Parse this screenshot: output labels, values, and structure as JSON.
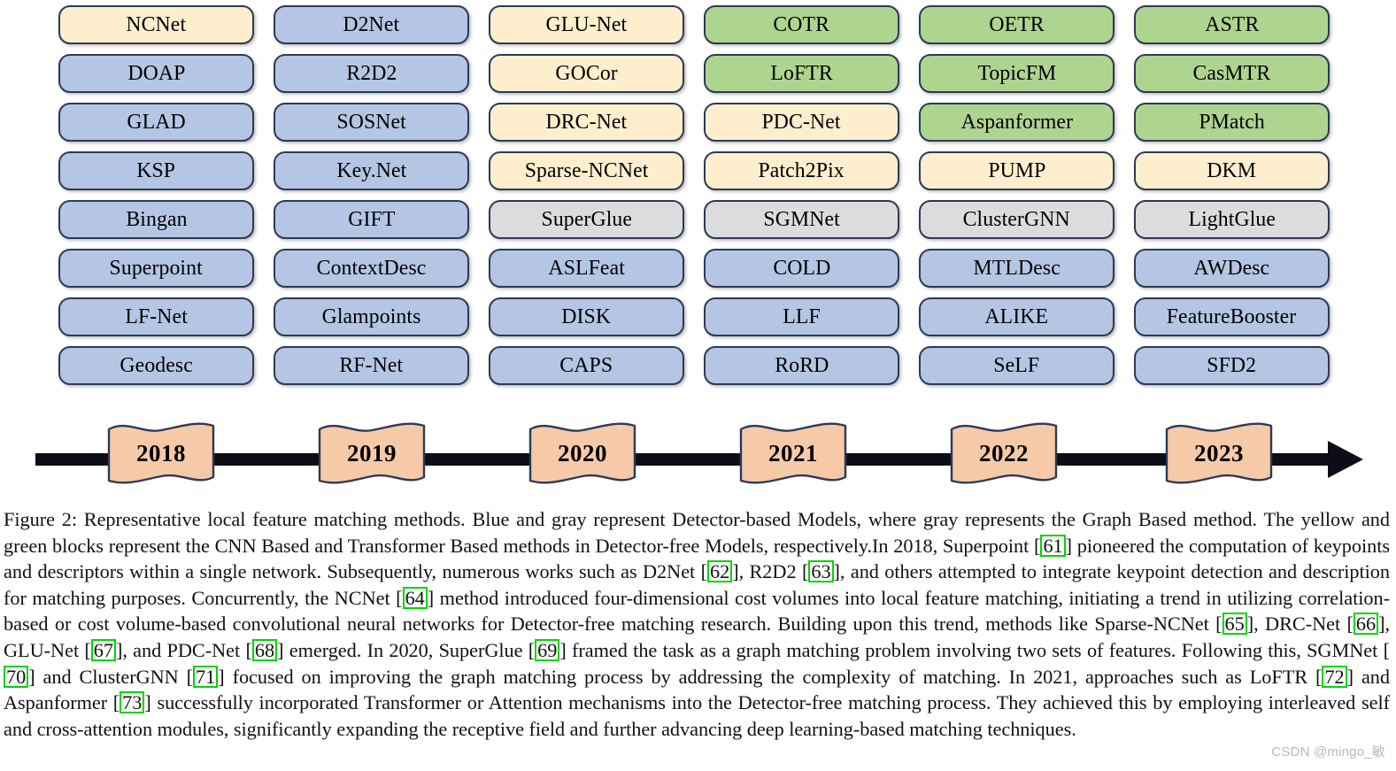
{
  "figure": {
    "legend_colors": {
      "blue": "#b4c6e3",
      "yellow": "#fdefcd",
      "green": "#aed590",
      "gray": "#dcdcdc",
      "ribbon": "#f6c9a8",
      "arrow": "#0d0d18",
      "border": "#2c3a55",
      "citation_box": "#00d500"
    },
    "columns": [
      {
        "year": "2018",
        "methods": [
          {
            "label": "NCNet",
            "color": "yellow"
          },
          {
            "label": "DOAP",
            "color": "blue"
          },
          {
            "label": "GLAD",
            "color": "blue"
          },
          {
            "label": "KSP",
            "color": "blue"
          },
          {
            "label": "Bingan",
            "color": "blue"
          },
          {
            "label": "Superpoint",
            "color": "blue"
          },
          {
            "label": "LF-Net",
            "color": "blue"
          },
          {
            "label": "Geodesc",
            "color": "blue"
          }
        ]
      },
      {
        "year": "2019",
        "methods": [
          {
            "label": "D2Net",
            "color": "blue"
          },
          {
            "label": "R2D2",
            "color": "blue"
          },
          {
            "label": "SOSNet",
            "color": "blue"
          },
          {
            "label": "Key.Net",
            "color": "blue"
          },
          {
            "label": "GIFT",
            "color": "blue"
          },
          {
            "label": "ContextDesc",
            "color": "blue"
          },
          {
            "label": "Glampoints",
            "color": "blue"
          },
          {
            "label": "RF-Net",
            "color": "blue"
          }
        ]
      },
      {
        "year": "2020",
        "methods": [
          {
            "label": "GLU-Net",
            "color": "yellow"
          },
          {
            "label": "GOCor",
            "color": "yellow"
          },
          {
            "label": "DRC-Net",
            "color": "yellow"
          },
          {
            "label": "Sparse-NCNet",
            "color": "yellow"
          },
          {
            "label": "SuperGlue",
            "color": "gray"
          },
          {
            "label": "ASLFeat",
            "color": "blue"
          },
          {
            "label": "DISK",
            "color": "blue"
          },
          {
            "label": "CAPS",
            "color": "blue"
          }
        ]
      },
      {
        "year": "2021",
        "methods": [
          {
            "label": "COTR",
            "color": "green"
          },
          {
            "label": "LoFTR",
            "color": "green"
          },
          {
            "label": "PDC-Net",
            "color": "yellow"
          },
          {
            "label": "Patch2Pix",
            "color": "yellow"
          },
          {
            "label": "SGMNet",
            "color": "gray"
          },
          {
            "label": "COLD",
            "color": "blue"
          },
          {
            "label": "LLF",
            "color": "blue"
          },
          {
            "label": "RoRD",
            "color": "blue"
          }
        ]
      },
      {
        "year": "2022",
        "methods": [
          {
            "label": "OETR",
            "color": "green"
          },
          {
            "label": "TopicFM",
            "color": "green"
          },
          {
            "label": "Aspanformer",
            "color": "green"
          },
          {
            "label": "PUMP",
            "color": "yellow"
          },
          {
            "label": "ClusterGNN",
            "color": "gray"
          },
          {
            "label": "MTLDesc",
            "color": "blue"
          },
          {
            "label": "ALIKE",
            "color": "blue"
          },
          {
            "label": "SeLF",
            "color": "blue"
          }
        ]
      },
      {
        "year": "2023",
        "methods": [
          {
            "label": "ASTR",
            "color": "green"
          },
          {
            "label": "CasMTR",
            "color": "green"
          },
          {
            "label": "PMatch",
            "color": "green"
          },
          {
            "label": "DKM",
            "color": "yellow"
          },
          {
            "label": "LightGlue",
            "color": "gray"
          },
          {
            "label": "AWDesc",
            "color": "blue"
          },
          {
            "label": "FeatureBooster",
            "color": "blue"
          },
          {
            "label": "SFD2",
            "color": "blue"
          }
        ]
      }
    ]
  },
  "caption": {
    "segments": [
      {
        "t": "Figure 2: Representative local feature matching methods.  Blue and gray represent Detector-based Models, where gray represents the Graph Based method.  The yellow and green blocks represent the CNN Based and Transformer Based methods in Detector-free Models, respectively.In 2018, Superpoint ["
      },
      {
        "t": "61",
        "cite": true
      },
      {
        "t": "] pioneered the computation of keypoints and descriptors within a single network.  Subsequently, numerous works such as D2Net ["
      },
      {
        "t": "62",
        "cite": true
      },
      {
        "t": "], R2D2 ["
      },
      {
        "t": "63",
        "cite": true
      },
      {
        "t": "], and others attempted to integrate keypoint detection and description for matching purposes.  Concurrently, the NCNet ["
      },
      {
        "t": "64",
        "cite": true
      },
      {
        "t": "] method introduced four-dimensional cost volumes into local feature matching, initiating a trend in utilizing correlation-based or cost volume-based convolutional neural networks for Detector-free matching research.  Building upon this trend, methods like Sparse-NCNet ["
      },
      {
        "t": "65",
        "cite": true
      },
      {
        "t": "], DRC-Net ["
      },
      {
        "t": "66",
        "cite": true
      },
      {
        "t": "], GLU-Net ["
      },
      {
        "t": "67",
        "cite": true
      },
      {
        "t": "], and PDC-Net ["
      },
      {
        "t": "68",
        "cite": true
      },
      {
        "t": "] emerged. In 2020, SuperGlue ["
      },
      {
        "t": "69",
        "cite": true
      },
      {
        "t": "] framed the task as a graph matching problem involving two sets of features.  Following this, SGMNet ["
      },
      {
        "t": "70",
        "cite": true
      },
      {
        "t": "] and ClusterGNN ["
      },
      {
        "t": "71",
        "cite": true
      },
      {
        "t": "] focused on improving the graph matching process by addressing the complexity of matching.  In 2021, approaches such as LoFTR ["
      },
      {
        "t": "72",
        "cite": true
      },
      {
        "t": "] and Aspanformer ["
      },
      {
        "t": "73",
        "cite": true
      },
      {
        "t": "] successfully incorporated Transformer or Attention mechanisms into the Detector-free matching process.  They achieved this by employing interleaved self and cross-attention modules, significantly expanding the receptive field and further advancing deep learning-based matching techniques."
      }
    ]
  },
  "watermark": {
    "text": "CSDN @mingo_敏"
  }
}
